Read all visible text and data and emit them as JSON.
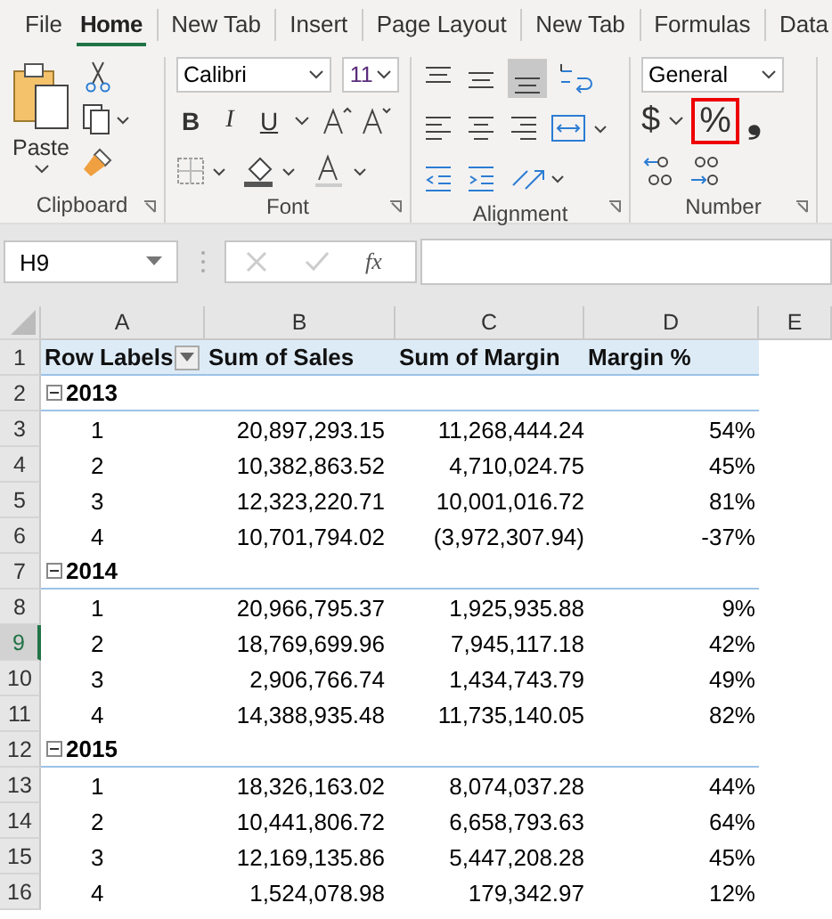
{
  "tabs": [
    {
      "label": "File",
      "selected": false
    },
    {
      "label": "Home",
      "selected": true
    },
    {
      "label": "New Tab",
      "selected": false
    },
    {
      "label": "Insert",
      "selected": false
    },
    {
      "label": "Page Layout",
      "selected": false
    },
    {
      "label": "New Tab",
      "selected": false
    },
    {
      "label": "Formulas",
      "selected": false
    },
    {
      "label": "Data",
      "selected": false
    }
  ],
  "ribbon": {
    "paste_label": "Paste",
    "font_name": "Calibri",
    "font_size": "11",
    "bold_label": "B",
    "italic_label": "I",
    "underline_label": "U",
    "number_format": "General",
    "currency_symbol": "$",
    "percent_symbol": "%",
    "percent_highlighted": true,
    "comma_symbol": "❟",
    "groups": [
      "Clipboard",
      "Font",
      "Alignment",
      "Number"
    ]
  },
  "formula_bar": {
    "name_box": "H9",
    "fx": "fx"
  },
  "columns": [
    "A",
    "B",
    "C",
    "D",
    "E"
  ],
  "rows": [
    {
      "num": "1",
      "kind": "header",
      "selected": false,
      "cells": [
        "Row Labels",
        "Sum of Sales",
        "Sum of Margin",
        "Margin %"
      ]
    },
    {
      "num": "2",
      "kind": "year",
      "selected": false,
      "expanded": true,
      "cells": [
        "2013"
      ]
    },
    {
      "num": "3",
      "kind": "item",
      "selected": false,
      "cells": [
        "1",
        "20,897,293.15",
        "11,268,444.24",
        "54%"
      ]
    },
    {
      "num": "4",
      "kind": "item",
      "selected": false,
      "cells": [
        "2",
        "10,382,863.52",
        "4,710,024.75",
        "45%"
      ]
    },
    {
      "num": "5",
      "kind": "item",
      "selected": false,
      "cells": [
        "3",
        "12,323,220.71",
        "10,001,016.72",
        "81%"
      ]
    },
    {
      "num": "6",
      "kind": "item",
      "selected": false,
      "cells": [
        "4",
        "10,701,794.02",
        "(3,972,307.94)",
        "-37%"
      ]
    },
    {
      "num": "7",
      "kind": "year",
      "selected": false,
      "expanded": true,
      "cells": [
        "2014"
      ]
    },
    {
      "num": "8",
      "kind": "item",
      "selected": false,
      "cells": [
        "1",
        "20,966,795.37",
        "1,925,935.88",
        "9%"
      ]
    },
    {
      "num": "9",
      "kind": "item",
      "selected": true,
      "cells": [
        "2",
        "18,769,699.96",
        "7,945,117.18",
        "42%"
      ]
    },
    {
      "num": "10",
      "kind": "item",
      "selected": false,
      "cells": [
        "3",
        "2,906,766.74",
        "1,434,743.79",
        "49%"
      ]
    },
    {
      "num": "11",
      "kind": "item",
      "selected": false,
      "cells": [
        "4",
        "14,388,935.48",
        "11,735,140.05",
        "82%"
      ]
    },
    {
      "num": "12",
      "kind": "year",
      "selected": false,
      "expanded": true,
      "cells": [
        "2015"
      ]
    },
    {
      "num": "13",
      "kind": "item",
      "selected": false,
      "cells": [
        "1",
        "18,326,163.02",
        "8,074,037.28",
        "44%"
      ]
    },
    {
      "num": "14",
      "kind": "item",
      "selected": false,
      "cells": [
        "2",
        "10,441,806.72",
        "6,658,793.63",
        "64%"
      ]
    },
    {
      "num": "15",
      "kind": "item",
      "selected": false,
      "cells": [
        "3",
        "12,169,135.86",
        "5,447,208.28",
        "45%"
      ]
    },
    {
      "num": "16",
      "kind": "item",
      "selected": false,
      "cells": [
        "4",
        "1,524,078.98",
        "179,342.97",
        "12%"
      ]
    }
  ]
}
